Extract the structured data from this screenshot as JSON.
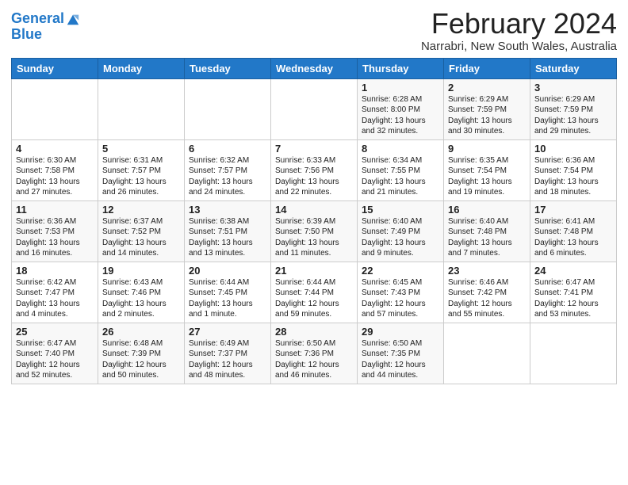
{
  "logo": {
    "line1": "General",
    "line2": "Blue"
  },
  "title": "February 2024",
  "subtitle": "Narrabri, New South Wales, Australia",
  "days_of_week": [
    "Sunday",
    "Monday",
    "Tuesday",
    "Wednesday",
    "Thursday",
    "Friday",
    "Saturday"
  ],
  "weeks": [
    [
      {
        "num": "",
        "info": ""
      },
      {
        "num": "",
        "info": ""
      },
      {
        "num": "",
        "info": ""
      },
      {
        "num": "",
        "info": ""
      },
      {
        "num": "1",
        "info": "Sunrise: 6:28 AM\nSunset: 8:00 PM\nDaylight: 13 hours\nand 32 minutes."
      },
      {
        "num": "2",
        "info": "Sunrise: 6:29 AM\nSunset: 7:59 PM\nDaylight: 13 hours\nand 30 minutes."
      },
      {
        "num": "3",
        "info": "Sunrise: 6:29 AM\nSunset: 7:59 PM\nDaylight: 13 hours\nand 29 minutes."
      }
    ],
    [
      {
        "num": "4",
        "info": "Sunrise: 6:30 AM\nSunset: 7:58 PM\nDaylight: 13 hours\nand 27 minutes."
      },
      {
        "num": "5",
        "info": "Sunrise: 6:31 AM\nSunset: 7:57 PM\nDaylight: 13 hours\nand 26 minutes."
      },
      {
        "num": "6",
        "info": "Sunrise: 6:32 AM\nSunset: 7:57 PM\nDaylight: 13 hours\nand 24 minutes."
      },
      {
        "num": "7",
        "info": "Sunrise: 6:33 AM\nSunset: 7:56 PM\nDaylight: 13 hours\nand 22 minutes."
      },
      {
        "num": "8",
        "info": "Sunrise: 6:34 AM\nSunset: 7:55 PM\nDaylight: 13 hours\nand 21 minutes."
      },
      {
        "num": "9",
        "info": "Sunrise: 6:35 AM\nSunset: 7:54 PM\nDaylight: 13 hours\nand 19 minutes."
      },
      {
        "num": "10",
        "info": "Sunrise: 6:36 AM\nSunset: 7:54 PM\nDaylight: 13 hours\nand 18 minutes."
      }
    ],
    [
      {
        "num": "11",
        "info": "Sunrise: 6:36 AM\nSunset: 7:53 PM\nDaylight: 13 hours\nand 16 minutes."
      },
      {
        "num": "12",
        "info": "Sunrise: 6:37 AM\nSunset: 7:52 PM\nDaylight: 13 hours\nand 14 minutes."
      },
      {
        "num": "13",
        "info": "Sunrise: 6:38 AM\nSunset: 7:51 PM\nDaylight: 13 hours\nand 13 minutes."
      },
      {
        "num": "14",
        "info": "Sunrise: 6:39 AM\nSunset: 7:50 PM\nDaylight: 13 hours\nand 11 minutes."
      },
      {
        "num": "15",
        "info": "Sunrise: 6:40 AM\nSunset: 7:49 PM\nDaylight: 13 hours\nand 9 minutes."
      },
      {
        "num": "16",
        "info": "Sunrise: 6:40 AM\nSunset: 7:48 PM\nDaylight: 13 hours\nand 7 minutes."
      },
      {
        "num": "17",
        "info": "Sunrise: 6:41 AM\nSunset: 7:48 PM\nDaylight: 13 hours\nand 6 minutes."
      }
    ],
    [
      {
        "num": "18",
        "info": "Sunrise: 6:42 AM\nSunset: 7:47 PM\nDaylight: 13 hours\nand 4 minutes."
      },
      {
        "num": "19",
        "info": "Sunrise: 6:43 AM\nSunset: 7:46 PM\nDaylight: 13 hours\nand 2 minutes."
      },
      {
        "num": "20",
        "info": "Sunrise: 6:44 AM\nSunset: 7:45 PM\nDaylight: 13 hours\nand 1 minute."
      },
      {
        "num": "21",
        "info": "Sunrise: 6:44 AM\nSunset: 7:44 PM\nDaylight: 12 hours\nand 59 minutes."
      },
      {
        "num": "22",
        "info": "Sunrise: 6:45 AM\nSunset: 7:43 PM\nDaylight: 12 hours\nand 57 minutes."
      },
      {
        "num": "23",
        "info": "Sunrise: 6:46 AM\nSunset: 7:42 PM\nDaylight: 12 hours\nand 55 minutes."
      },
      {
        "num": "24",
        "info": "Sunrise: 6:47 AM\nSunset: 7:41 PM\nDaylight: 12 hours\nand 53 minutes."
      }
    ],
    [
      {
        "num": "25",
        "info": "Sunrise: 6:47 AM\nSunset: 7:40 PM\nDaylight: 12 hours\nand 52 minutes."
      },
      {
        "num": "26",
        "info": "Sunrise: 6:48 AM\nSunset: 7:39 PM\nDaylight: 12 hours\nand 50 minutes."
      },
      {
        "num": "27",
        "info": "Sunrise: 6:49 AM\nSunset: 7:37 PM\nDaylight: 12 hours\nand 48 minutes."
      },
      {
        "num": "28",
        "info": "Sunrise: 6:50 AM\nSunset: 7:36 PM\nDaylight: 12 hours\nand 46 minutes."
      },
      {
        "num": "29",
        "info": "Sunrise: 6:50 AM\nSunset: 7:35 PM\nDaylight: 12 hours\nand 44 minutes."
      },
      {
        "num": "",
        "info": ""
      },
      {
        "num": "",
        "info": ""
      }
    ]
  ]
}
